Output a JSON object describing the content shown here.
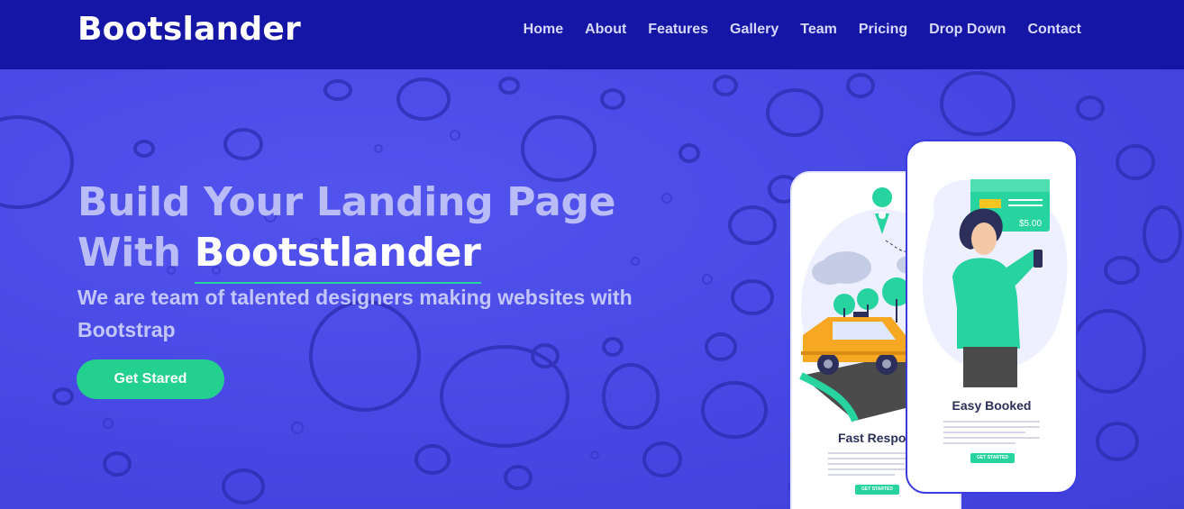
{
  "header": {
    "logo": "Bootslander",
    "nav": [
      "Home",
      "About",
      "Features",
      "Gallery",
      "Team",
      "Pricing",
      "Drop Down",
      "Contact"
    ]
  },
  "hero": {
    "title_line1": "Build Your Landing Page",
    "title_with": "With ",
    "title_brand": "Bootstlander",
    "subtitle": "We are team of talented designers making websites with Bootstrap",
    "cta_label": "Get Stared"
  },
  "phones": {
    "back_caption": "Fast Respon",
    "back_btn": "GET STARTED",
    "front_caption": "Easy Booked",
    "front_btn": "GET STARTED",
    "price": "$5.00"
  },
  "colors": {
    "navbar": "#1616a6",
    "hero_bg": "#4b4ae8",
    "accent": "#24d08e"
  }
}
